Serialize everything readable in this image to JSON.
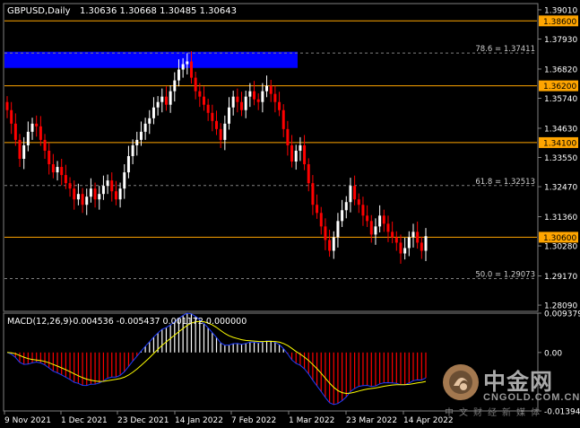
{
  "chart_header": {
    "symbol": "GBPUSD,Daily",
    "ohlc": "1.30636 1.30668 1.30485 1.30643"
  },
  "macd_header": {
    "label": "MACD(12,26,9)",
    "values": "-0.004536 -0.005437 0.001172 0.000000"
  },
  "watermark": {
    "brand": "中金网",
    "domain": "CNGOLD.COM.CN",
    "slogan": "中文财经新媒体"
  },
  "colors": {
    "background": "#000000",
    "frame": "#7f7f7f",
    "bull_candle": "#ffffff",
    "bear_candle": "#ff0000",
    "level_line": "#ffa500",
    "level_label_bg": "#ffa500",
    "zone": "#0000ff",
    "fib_line": "#808080",
    "macd_positive": "#ffffff",
    "macd_negative": "#ff0000",
    "macd_line": "#1e3cff",
    "signal_line": "#ffff00"
  },
  "chart_data": {
    "type": "candlestick",
    "title": "GBPUSD,Daily",
    "price_axis": {
      "ylim": [
        1.2786,
        1.3924
      ],
      "ticks": [
        "1.39010",
        "1.37930",
        "1.36820",
        "1.35740",
        "1.34630",
        "1.33550",
        "1.32470",
        "1.31360",
        "1.30280",
        "1.29170",
        "1.28090"
      ]
    },
    "time_axis": {
      "labels": [
        "9 Nov 2021",
        "1 Dec 2021",
        "23 Dec 2021",
        "14 Jan 2022",
        "7 Feb 2022",
        "1 Mar 2022",
        "23 Mar 2022",
        "14 Apr 2022"
      ]
    },
    "horizontal_levels": [
      {
        "value": 1.386,
        "label": "1.38600"
      },
      {
        "value": 1.362,
        "label": "1.36200"
      },
      {
        "value": 1.341,
        "label": "1.34100"
      },
      {
        "value": 1.306,
        "label": "1.30600"
      }
    ],
    "fibonacci_levels": [
      {
        "value": 1.37411,
        "label": "78.6 = 1.37411"
      },
      {
        "value": 1.32513,
        "label": "61.8 = 1.32513"
      },
      {
        "value": 1.29073,
        "label": "50.0 = 1.29073"
      }
    ],
    "supply_zone": {
      "from_date": "9 Nov 2021",
      "to_date": "1 Feb 2022",
      "low": 1.3686,
      "high": 1.3746
    },
    "closes": [
      1.353,
      1.348,
      1.342,
      1.335,
      1.34,
      1.345,
      1.348,
      1.347,
      1.342,
      1.338,
      1.333,
      1.33,
      1.332,
      1.329,
      1.326,
      1.324,
      1.32,
      1.322,
      1.318,
      1.321,
      1.324,
      1.32,
      1.322,
      1.325,
      1.327,
      1.323,
      1.32,
      1.324,
      1.33,
      1.336,
      1.34,
      1.342,
      1.345,
      1.348,
      1.35,
      1.354,
      1.356,
      1.358,
      1.355,
      1.36,
      1.364,
      1.368,
      1.37,
      1.371,
      1.365,
      1.36,
      1.358,
      1.355,
      1.352,
      1.349,
      1.346,
      1.342,
      1.348,
      1.354,
      1.358,
      1.356,
      1.353,
      1.358,
      1.36,
      1.357,
      1.356,
      1.36,
      1.362,
      1.359,
      1.356,
      1.353,
      1.346,
      1.34,
      1.334,
      1.338,
      1.34,
      1.333,
      1.326,
      1.318,
      1.315,
      1.31,
      1.305,
      1.301,
      1.306,
      1.312,
      1.316,
      1.319,
      1.325,
      1.32,
      1.318,
      1.314,
      1.312,
      1.307,
      1.31,
      1.314,
      1.311,
      1.308,
      1.306,
      1.304,
      1.3,
      1.302,
      1.306,
      1.308,
      1.304,
      1.301,
      1.3064
    ],
    "macd": {
      "label": "MACD(12,26,9)",
      "ylim": [
        -0.01394,
        0.009379
      ],
      "ticks": [
        "0.009379",
        "0.00",
        "-0.013941"
      ],
      "main": -0.004536,
      "signal": -0.005437,
      "osma": 0.001172
    }
  }
}
